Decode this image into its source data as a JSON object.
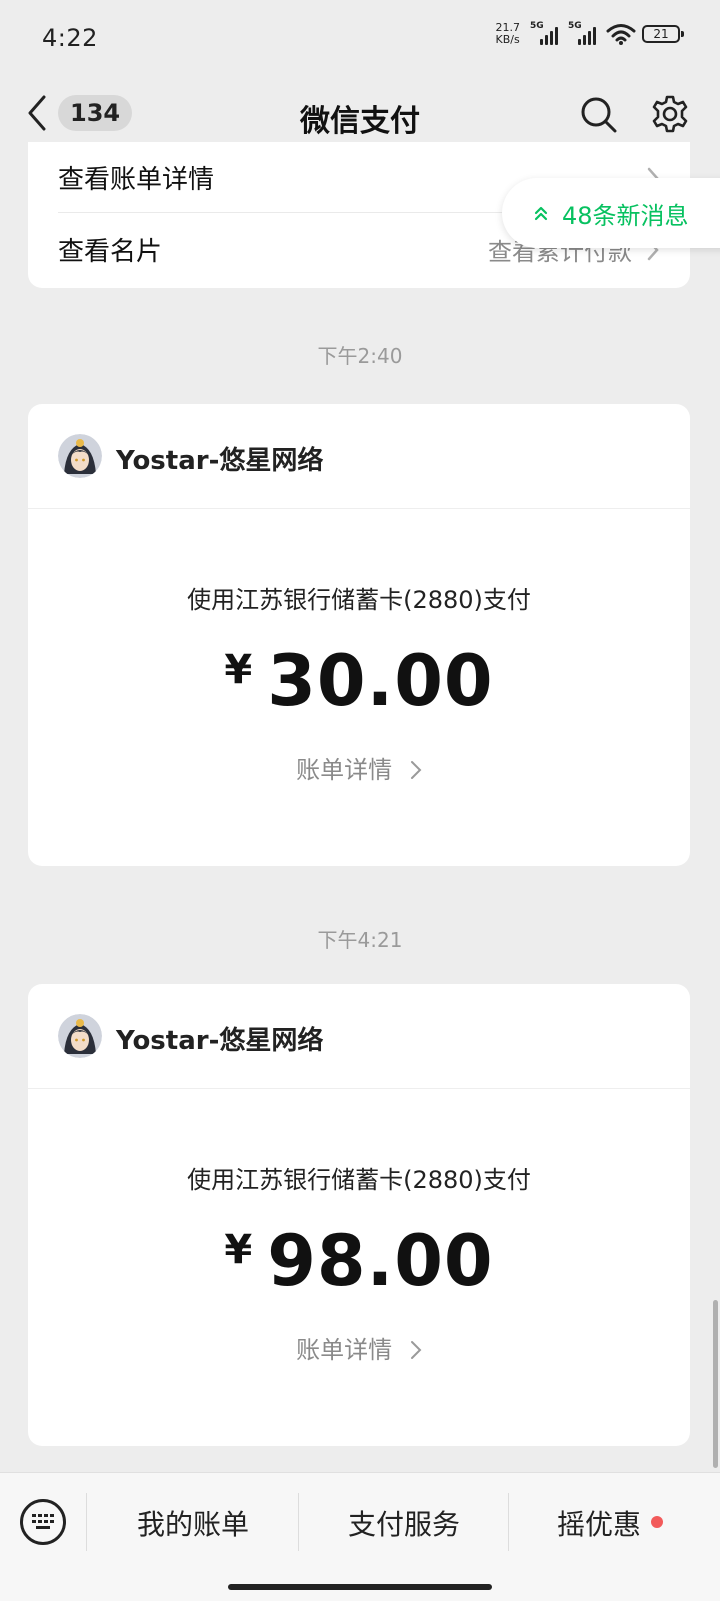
{
  "status_bar": {
    "time": "4:22",
    "net_speed_value": "21.7",
    "net_speed_unit": "KB/s",
    "sim1": "5G",
    "sim2": "5G",
    "battery": "21"
  },
  "header": {
    "badge_count": "134",
    "title": "微信支付",
    "icons": [
      "back-chevron-icon",
      "search-icon",
      "gear-icon"
    ]
  },
  "top_card": {
    "row1_label": "查看账单详情",
    "row2_label": "查看名片",
    "row2_right": "查看累计付款"
  },
  "new_messages": "48条新消息",
  "payments": [
    {
      "timestamp": "下午2:40",
      "merchant": "Yostar-悠星网络",
      "desc": "使用江苏银行储蓄卡(2880)支付",
      "currency": "¥",
      "amount": "30.00",
      "detail": "账单详情"
    },
    {
      "timestamp": "下午4:21",
      "merchant": "Yostar-悠星网络",
      "desc": "使用江苏银行储蓄卡(2880)支付",
      "currency": "¥",
      "amount": "98.00",
      "detail": "账单详情"
    }
  ],
  "bottom_bar": {
    "item1": "我的账单",
    "item2": "支付服务",
    "item3": "摇优惠"
  },
  "colors": {
    "accent_green": "#07c160",
    "background": "#ededed",
    "red_dot": "#f25a5a"
  }
}
